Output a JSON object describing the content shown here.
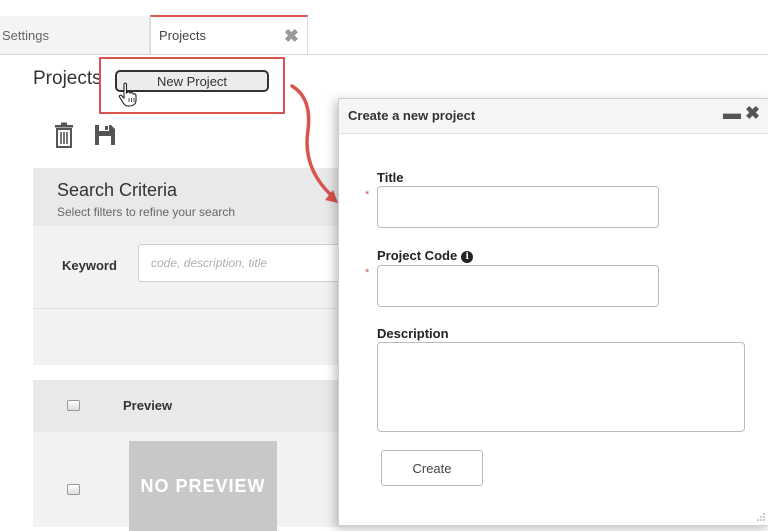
{
  "tabs": [
    {
      "label": "Settings"
    },
    {
      "label": "Projects"
    }
  ],
  "page": {
    "title": "Projects",
    "new_project_label": "New Project"
  },
  "search": {
    "title": "Search Criteria",
    "subtitle": "Select filters to refine your search",
    "keyword_label": "Keyword",
    "keyword_placeholder": "code, description, title"
  },
  "table": {
    "column_preview": "Preview",
    "no_preview_text": "NO PREVIEW"
  },
  "dialog": {
    "title": "Create a new project",
    "minimize_icon": "minimize-icon",
    "close_icon": "close-icon",
    "title_label": "Title",
    "project_code_label": "Project Code",
    "description_label": "Description",
    "required_marker": "*",
    "create_label": "Create"
  },
  "colors": {
    "accent_red": "#d9534f",
    "panel_bg": "#f2f2f2"
  }
}
